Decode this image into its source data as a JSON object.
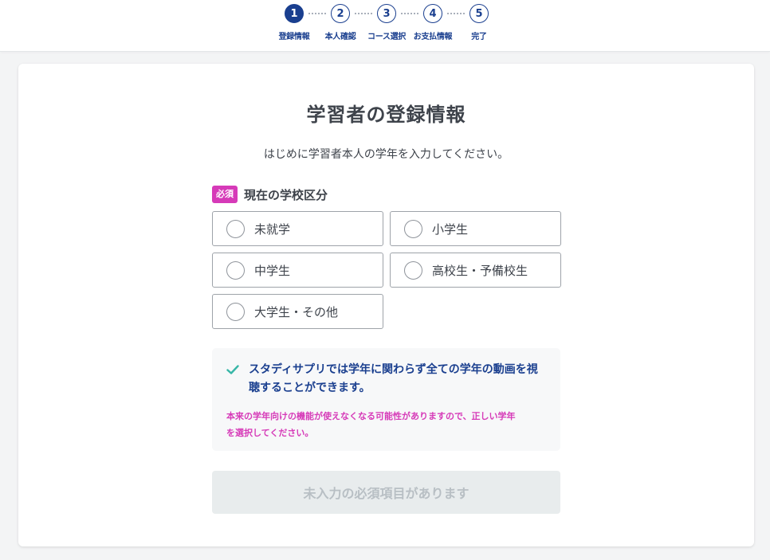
{
  "stepper": {
    "steps": [
      {
        "number": "1",
        "label": "登録情報",
        "active": true
      },
      {
        "number": "2",
        "label": "本人確認",
        "active": false
      },
      {
        "number": "3",
        "label": "コース選択",
        "active": false
      },
      {
        "number": "4",
        "label": "お支払情報",
        "active": false
      },
      {
        "number": "5",
        "label": "完了",
        "active": false
      }
    ]
  },
  "form": {
    "title": "学習者の登録情報",
    "intro": "はじめに学習者本人の学年を入力してください。",
    "required_badge": "必須",
    "field_label": "現在の学校区分",
    "options": [
      {
        "label": "未就学",
        "selected": false
      },
      {
        "label": "小学生",
        "selected": false
      },
      {
        "label": "中学生",
        "selected": false
      },
      {
        "label": "高校生・予備校生",
        "selected": false
      },
      {
        "label": "大学生・その他",
        "selected": false
      }
    ]
  },
  "notice": {
    "icon": "check-icon",
    "main_line1": "スタディサプリでは学年に関わらず全ての学年の動画を視",
    "main_line2": "聴することができます。",
    "warning_line1": "本来の学年向けの機能が使えなくなる可能性がありますので、正しい学年",
    "warning_line2": "を選択してください。"
  },
  "submit": {
    "label": "未入力の必須項目があります",
    "disabled": true
  },
  "colors": {
    "navy": "#1a3f8f",
    "magenta": "#d63ab8",
    "teal_check": "#37b6a7",
    "page_bg": "#f3f4f5",
    "disabled_bg": "#e8eced",
    "disabled_text": "#b8bfc4"
  }
}
